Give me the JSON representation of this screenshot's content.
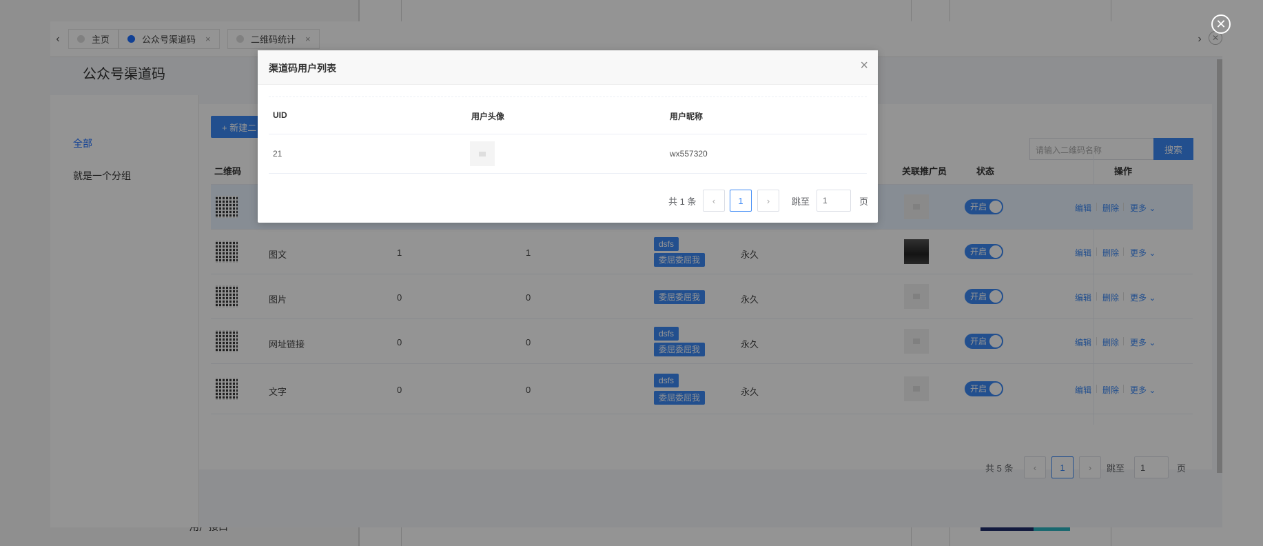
{
  "background": {
    "bottom_text": "用户接口"
  },
  "frame": {
    "tabs": [
      {
        "label": "主页",
        "active": false,
        "closable": false
      },
      {
        "label": "公众号渠道码",
        "active": true,
        "closable": true
      },
      {
        "label": "二维码统计",
        "active": false,
        "closable": true
      }
    ],
    "tab_close_glyph": "×",
    "page_title": "公众号渠道码",
    "sidebar": [
      {
        "label": "全部",
        "active": true
      },
      {
        "label": "就是一个分组",
        "active": false
      }
    ],
    "new_button": "+ 新建二",
    "search_placeholder": "请输入二维码名称",
    "search_button": "搜索",
    "table": {
      "headers": {
        "qrcode": "二维码",
        "promoter": "关联推广员",
        "status": "状态",
        "actions": "操作"
      },
      "rows": [
        {
          "type": "",
          "a": "",
          "b": "",
          "tags": [],
          "expire": "",
          "promoter": "logo",
          "status": "开启",
          "highlighted": true
        },
        {
          "type": "图文",
          "a": "1",
          "b": "1",
          "tags": [
            "dsfs",
            "委屈委屈我"
          ],
          "expire": "永久",
          "promoter": "photo",
          "status": "开启",
          "highlighted": false
        },
        {
          "type": "图片",
          "a": "0",
          "b": "0",
          "tags": [
            "委屈委屈我"
          ],
          "expire": "永久",
          "promoter": "placeholder",
          "status": "开启",
          "highlighted": false
        },
        {
          "type": "网址链接",
          "a": "0",
          "b": "0",
          "tags": [
            "dsfs",
            "委屈委屈我"
          ],
          "expire": "永久",
          "promoter": "placeholder",
          "status": "开启",
          "highlighted": false
        },
        {
          "type": "文字",
          "a": "0",
          "b": "0",
          "tags": [
            "dsfs",
            "委屈委屈我"
          ],
          "expire": "永久",
          "promoter": "placeholder",
          "status": "开启",
          "highlighted": false
        }
      ],
      "actions": {
        "edit": "编辑",
        "delete": "删除",
        "more": "更多 ⌄"
      }
    },
    "pagination": {
      "total": "共 5 条",
      "prev": "‹",
      "current": "1",
      "next": "›",
      "jump_label": "跳至",
      "jump_value": "1",
      "page_suffix": "页"
    }
  },
  "dialog": {
    "title": "渠道码用户列表",
    "close_glyph": "×",
    "columns": [
      "UID",
      "用户头像",
      "用户昵称"
    ],
    "rows": [
      {
        "uid": "21",
        "avatar": "placeholder",
        "nickname": "wx557320"
      }
    ],
    "pagination": {
      "total": "共 1 条",
      "prev": "‹",
      "current": "1",
      "next": "›",
      "jump_label": "跳至",
      "jump_value": "1",
      "page_suffix": "页"
    }
  },
  "outer_close_glyph": "✕",
  "colors": {
    "primary": "#3b88f5",
    "overlay": "rgba(0,0,0,0.42)"
  }
}
